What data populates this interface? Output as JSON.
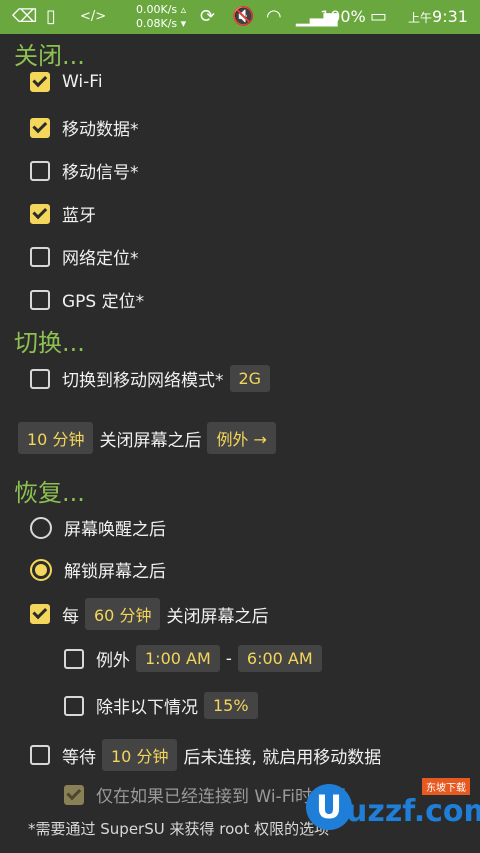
{
  "status_bar": {
    "speed_up": "0.00K/s",
    "speed_down": "0.08K/s",
    "battery": "100%",
    "time_prefix": "上午",
    "time": "9:31",
    "icons": [
      "back-icon",
      "device-icon",
      "code-icon",
      "sync-icon",
      "mute-icon",
      "wifi-icon",
      "signal-icon",
      "battery-icon"
    ]
  },
  "sections": {
    "close": "关闭...",
    "switch": "切换...",
    "restore": "恢复..."
  },
  "close_items": [
    {
      "label": "Wi-Fi",
      "checked": true
    },
    {
      "label": "移动数据*",
      "checked": true
    },
    {
      "label": "移动信号*",
      "checked": false
    },
    {
      "label": "蓝牙",
      "checked": true
    },
    {
      "label": "网络定位*",
      "checked": false
    },
    {
      "label": "GPS 定位*",
      "checked": false
    }
  ],
  "switch_item": {
    "label": "切换到移动网络模式*",
    "value": "2G",
    "checked": false
  },
  "timer_row": {
    "duration": "10 分钟",
    "text": "关闭屏幕之后",
    "exception": "例外 →"
  },
  "restore": {
    "radio_wake": "屏幕唤醒之后",
    "radio_unlock": "解锁屏幕之后",
    "every_prefix": "每",
    "every_value": "60 分钟",
    "every_suffix": "关闭屏幕之后",
    "except_label": "例外",
    "except_from": "1:00 AM",
    "except_dash": "-",
    "except_to": "6:00 AM",
    "unless_label": "除非以下情况",
    "unless_value": "15%",
    "wait_prefix": "等待",
    "wait_value": "10 分钟",
    "wait_suffix": "后未连接, 就启用移动数据",
    "only_if": "仅在如果已经连接到 Wi-Fi时关闭"
  },
  "footnote": "*需要通过 SuperSU 来获得 root 权限的选项",
  "watermark": {
    "letter": "U",
    "text": "uzzf.com",
    "tag": "东坡下载"
  },
  "colors": {
    "accent": "#f4d65a",
    "section": "#8cc152",
    "statusbar": "#6aa83f",
    "background": "#2b2b2b"
  }
}
